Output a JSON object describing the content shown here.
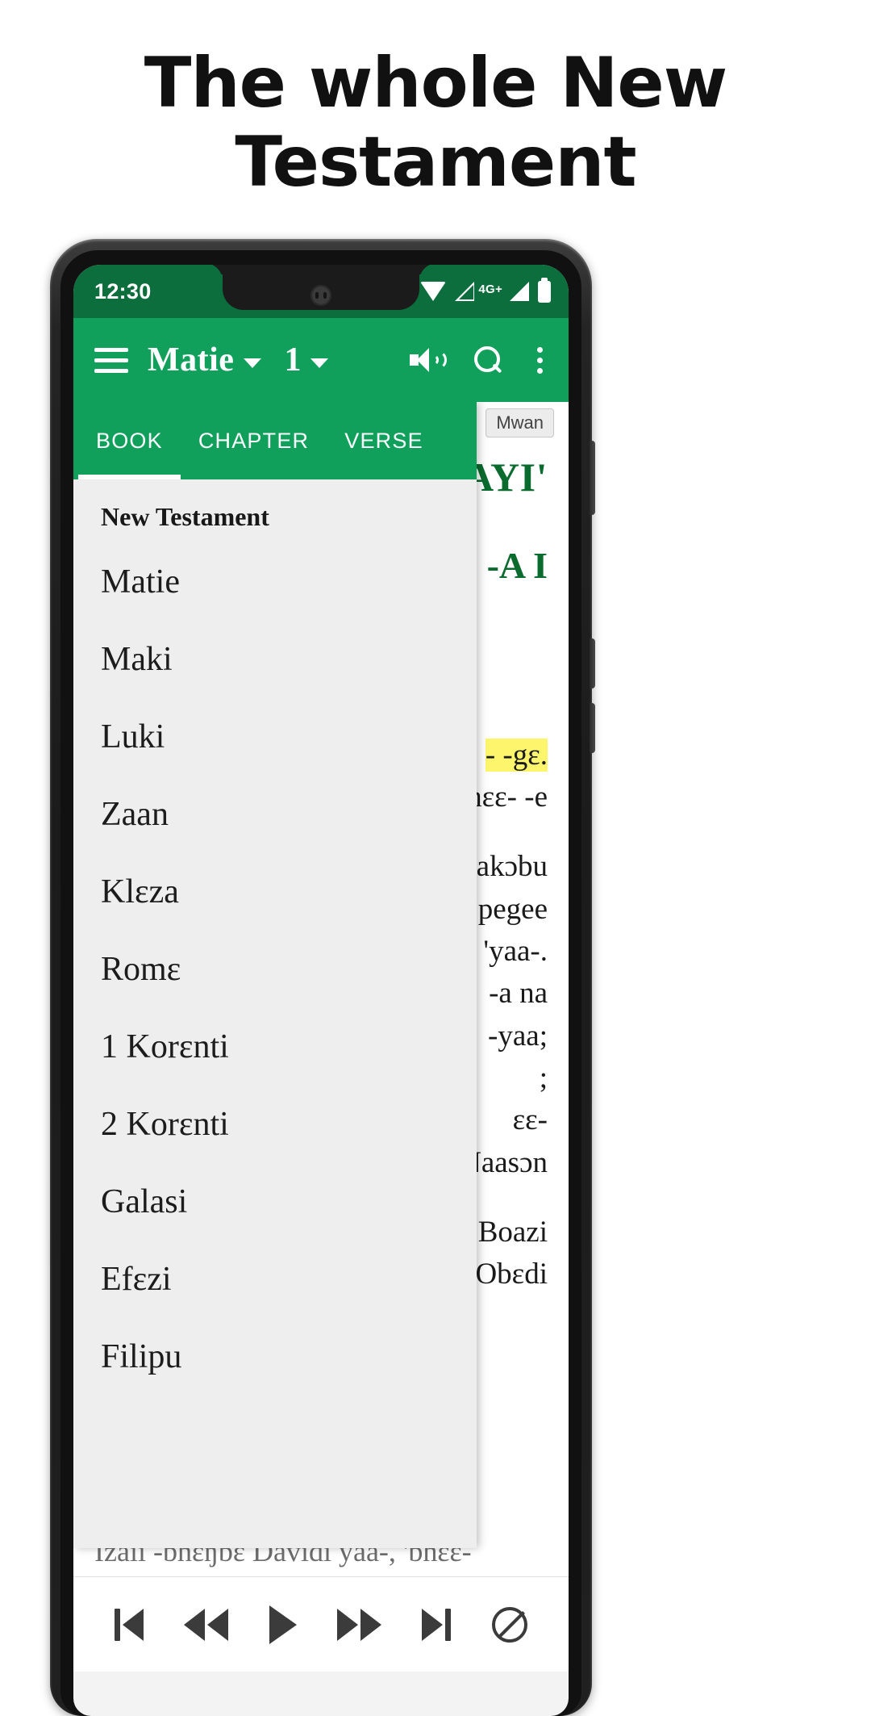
{
  "promo": {
    "headline": "The whole New Testament"
  },
  "statusbar": {
    "time": "12:30",
    "network_label": "4G+",
    "icons": [
      "wifi-icon",
      "signal-hollow-icon",
      "signal-icon",
      "battery-icon"
    ]
  },
  "appbar": {
    "menu_icon": "hamburger-menu-icon",
    "book": "Matie",
    "chapter": "1",
    "actions": [
      "speaker-icon",
      "search-icon",
      "overflow-menu-icon"
    ]
  },
  "dropdown": {
    "tabs": [
      {
        "label": "BOOK",
        "active": true
      },
      {
        "label": "CHAPTER",
        "active": false
      },
      {
        "label": "VERSE",
        "active": false
      }
    ],
    "section_title": "New Testament",
    "books": [
      "Matie",
      "Maki",
      "Luki",
      "Zaan",
      "Klɛza",
      "Romɛ",
      "1 Korɛnti",
      "2 Korɛnti",
      "Galasi",
      "Efɛzi",
      "Filipu"
    ]
  },
  "scripture": {
    "version_badge": "Mwan",
    "heading_1": "E- 'LA ZAYI'",
    "heading_2": "E -A I",
    "lines": [
      "- -gɛ.",
      "'Bhɛɛ- -e",
      "akɔbu",
      "la 'pegee",
      "'ɛ 'yaa-.",
      "-a na",
      "-yaa;",
      ";",
      "ɛɛ-",
      "a; Naasɔn",
      "Boazi",
      "ɛ- Obɛdi"
    ],
    "highlight_line": "- -gɛ.",
    "bottom_line": "Izaii -bhɛŋɓɛ Davidi yaa-, 'bhɛɛ-"
  },
  "bottombar": {
    "buttons": [
      "skip-to-start-icon",
      "rewind-icon",
      "play-icon",
      "fast-forward-icon",
      "skip-to-end-icon",
      "no-repeat-icon"
    ]
  },
  "colors": {
    "status_green": "#0b6e3c",
    "appbar_green": "#10a05b",
    "heading_green": "#0a6b2e",
    "highlight_yellow": "#fdf56b"
  }
}
